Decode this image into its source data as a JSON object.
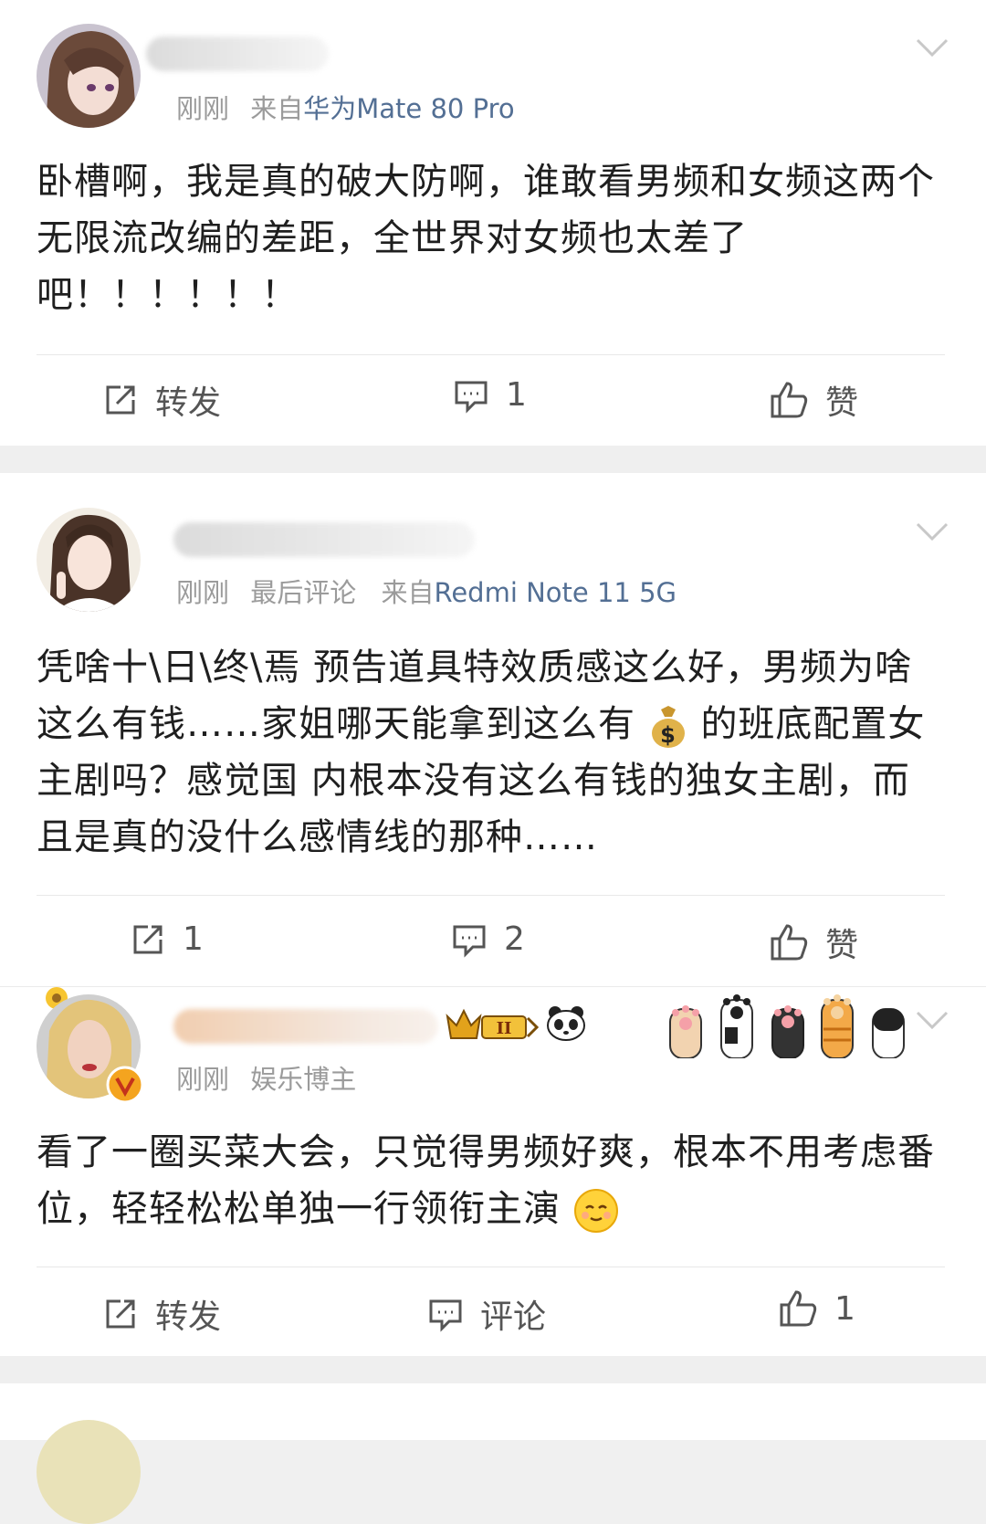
{
  "posts": [
    {
      "time": "刚刚",
      "source_prefix": "来自",
      "device": "华为Mate 80 Pro",
      "content": "卧槽啊，我是真的破大防啊，谁敢看男频和女频这两个无限流改编的差距，全世界对女频也太差了吧！！！！！！",
      "actions": {
        "repost": "转发",
        "comment": "1",
        "like": "赞"
      }
    },
    {
      "time": "刚刚",
      "last_comment": "最后评论",
      "source_prefix": "来自",
      "device": "Redmi Note 11 5G",
      "content_part1": "凭啥十\\日\\终\\焉 预告道具特效质感这么好，男频为啥这么有钱……家姐哪天能拿到这么有",
      "content_part2": "的班底配置女主剧吗？感觉国 内根本没有这么有钱的独女主剧，而且是真的没什么感情线的那种……",
      "actions": {
        "repost": "1",
        "comment": "2",
        "like": "赞"
      }
    },
    {
      "time": "刚刚",
      "tag": "娱乐博主",
      "content": "看了一圈买菜大会，只觉得男频好爽，根本不用考虑番位，轻轻松松单独一行领衔主演",
      "actions": {
        "repost": "转发",
        "comment": "评论",
        "like": "1"
      }
    }
  ],
  "icons": [
    "repost-icon",
    "comment-icon",
    "like-icon",
    "chevron-down-icon",
    "money-bag-emoji",
    "smile-emoji",
    "panda-icon",
    "crown-badge-icon",
    "cat-paw-icon"
  ],
  "colors": {
    "device_link": "#536f94",
    "meta": "#9b9b9b",
    "background": "#f0f0f0",
    "name_orange": "#e8a060"
  }
}
